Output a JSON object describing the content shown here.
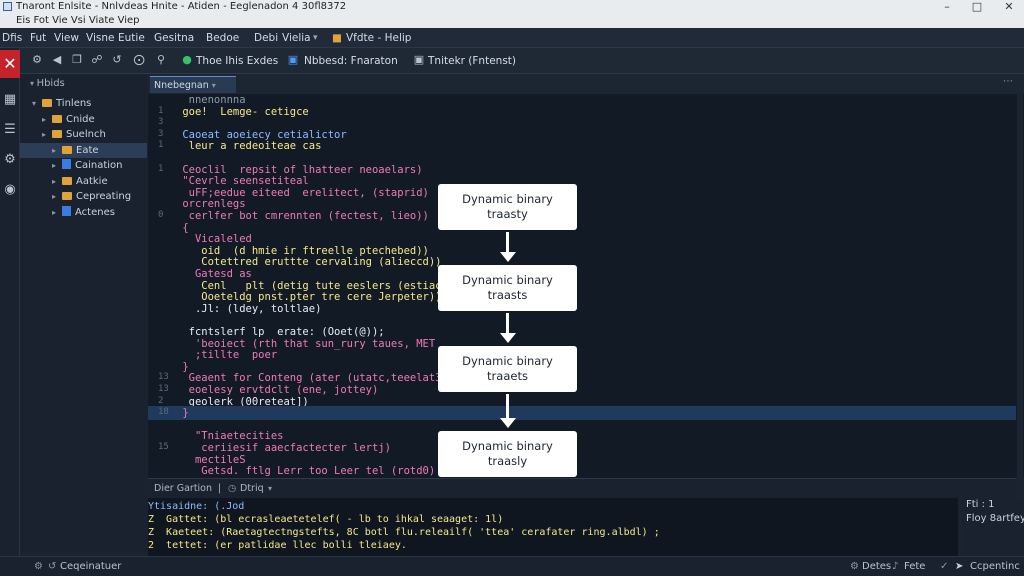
{
  "window": {
    "title": "Tnaront Enlsite - Nnlvdeas Hnite - Atiden - Eeglenadon 4 30fl8372",
    "menu_top": "Eis  Fot  Vie  Vsi  Viate  Viep"
  },
  "menubar": {
    "items": [
      "Dfis",
      "Fut",
      "View",
      "Visne",
      "Eutie",
      "Gesitna",
      "Bedoe",
      "Debi",
      "Vielia",
      "Vfdte - Helip"
    ]
  },
  "toolbar": {
    "run1": "Thoe Ihis Exdes",
    "run2": "Nbbesd: Fnaraton",
    "run3": "Tnitekr (Fntenst)"
  },
  "sidebar": {
    "header": "Hbids",
    "items": [
      {
        "label": "Tinlens",
        "indent": 0,
        "type": "folder",
        "expanded": true
      },
      {
        "label": "Cnide",
        "indent": 1,
        "type": "folder"
      },
      {
        "label": "Suelnch",
        "indent": 1,
        "type": "folder"
      },
      {
        "label": "Eate",
        "indent": 2,
        "type": "folder",
        "selected": true
      },
      {
        "label": "Caination",
        "indent": 2,
        "type": "file"
      },
      {
        "label": "Aatkie",
        "indent": 2,
        "type": "folder"
      },
      {
        "label": "Cepreating",
        "indent": 2,
        "type": "folder"
      },
      {
        "label": "Actenes",
        "indent": 2,
        "type": "file"
      }
    ]
  },
  "editor": {
    "tab": "Nnebegnan",
    "lines": [
      {
        "n": "",
        "text": "  nnenonnna",
        "color": "c-gray"
      },
      {
        "n": "1",
        "text": " goe!  Lemge- cetigce",
        "color": "c-yellow"
      },
      {
        "n": "3",
        "text": "",
        "color": "c-white"
      },
      {
        "n": "3",
        "text": " Caoeat aoeiecy cetialictor",
        "color": "c-blue"
      },
      {
        "n": "1",
        "text": "  leur a redeoiteae cas",
        "color": "c-yellow"
      },
      {
        "n": "",
        "text": "",
        "color": "c-white"
      },
      {
        "n": "1",
        "text": " Ceoclil  repsit of lhatteer neoaelars)",
        "color": "c-pink"
      },
      {
        "n": "",
        "text": " \"Cevrle seensetiteal",
        "color": "c-pink"
      },
      {
        "n": "",
        "text": "  uFF;eedue eiteed  erelitect, (staprid)",
        "color": "c-pink"
      },
      {
        "n": "",
        "text": " orcrenlegs",
        "color": "c-pink"
      },
      {
        "n": "0",
        "text": "  cerlfer bot cmrennten (fectest, lieo))",
        "color": "c-pink"
      },
      {
        "n": "",
        "text": " {",
        "color": "c-pink"
      },
      {
        "n": "",
        "text": "   Vicaleled",
        "color": "c-pink"
      },
      {
        "n": "",
        "text": "    oid  (d hmie ir ftreelle ptechebed))",
        "color": "c-yellow"
      },
      {
        "n": "",
        "text": "    Cotettred eruttte cervaling (alieccd))",
        "color": "c-yellow"
      },
      {
        "n": "",
        "text": "   Gatesd as",
        "color": "c-pink"
      },
      {
        "n": "",
        "text": "    Cenl   plt (detig tute eeslers (estiac",
        "color": "c-yellow"
      },
      {
        "n": "",
        "text": "    Ooeteldg pnst.pter tre cere Jerpeter))",
        "color": "c-yellow"
      },
      {
        "n": "",
        "text": "   .Jl: (ldey, toltlae)",
        "color": "c-white"
      },
      {
        "n": "",
        "text": "",
        "color": "c-white"
      },
      {
        "n": "",
        "text": "  fcntslerf lp  erate: (Ooet(@));",
        "color": "c-white"
      },
      {
        "n": "",
        "text": "   'beoiect (rth that sun_rury taues, MET",
        "color": "c-pink"
      },
      {
        "n": "",
        "text": "   ;tillte  poer",
        "color": "c-pink"
      },
      {
        "n": "",
        "text": " }",
        "color": "c-pink"
      },
      {
        "n": "13",
        "text": "  Geaent for Conteng (ater (utatc,teeelat3))",
        "color": "c-pink"
      },
      {
        "n": "13",
        "text": "  eoelesy ervtdclt (ene, jottey)",
        "color": "c-pink"
      },
      {
        "n": "2",
        "text": "  geolerk (00reteat])",
        "color": "c-white"
      },
      {
        "n": "18",
        "text": " }",
        "color": "c-pink",
        "highlight": true
      },
      {
        "n": "",
        "text": "",
        "color": "c-white"
      },
      {
        "n": "",
        "text": "   \"Tniaetecities",
        "color": "c-pink"
      },
      {
        "n": "15",
        "text": "    ceriiesif aaecfactecter lertj)",
        "color": "c-pink"
      },
      {
        "n": "",
        "text": "   mectileS",
        "color": "c-pink"
      },
      {
        "n": "",
        "text": "    Getsd. ftlg Lerr too Leer tel (rotd0)",
        "color": "c-pink"
      }
    ]
  },
  "flowchart": {
    "boxes": [
      {
        "line1": "Dynamic binary",
        "line2": "traasty"
      },
      {
        "line1": "Dynamic binary",
        "line2": "traasts"
      },
      {
        "line1": "Dynamic binary",
        "line2": "traaets"
      },
      {
        "line1": "Dynamic binary",
        "line2": "traasly"
      }
    ]
  },
  "panel": {
    "tab1": "Dier Gartion",
    "tab2": "Dtriq",
    "lines": [
      {
        "text": "Ytisaidne: (.Jod",
        "color": "c-blue"
      },
      {
        "text": "Z  Gattet: (bl ecrasleaetetelef( - lb to ihkal seaaget: 1l)",
        "color": "c-yellow"
      },
      {
        "text": "Z  Kaeteet: (Raetagtectngstefts, 8C botl flu.releailf( 'ttea' cerafater ring.albdl) ;",
        "color": "c-yellow"
      },
      {
        "text": "2  tettet: (er patlidae llec bolli tleiaey.",
        "color": "c-yellow"
      }
    ],
    "side": [
      "Fti  :  1",
      "Floy 8artfey"
    ]
  },
  "status": {
    "left": "Ceqeinatuer",
    "right1": "Detes",
    "right2": "Fete",
    "right3": "Ccpentinc"
  }
}
